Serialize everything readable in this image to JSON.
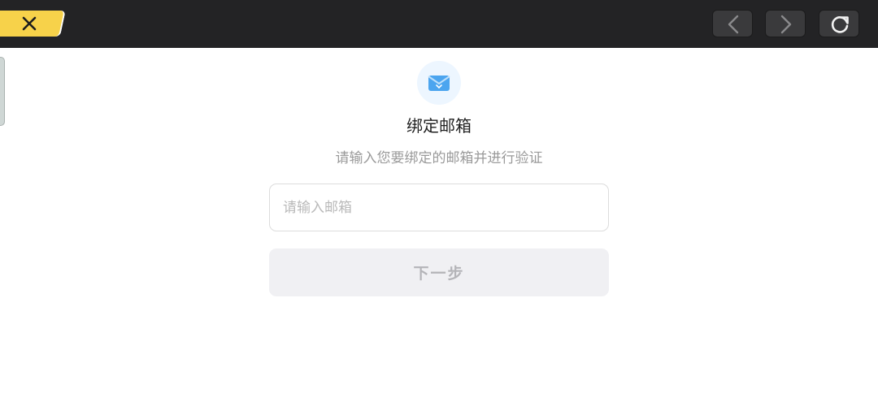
{
  "toolbar": {
    "close_icon": "close-icon",
    "back_icon": "chevron-left-icon",
    "forward_icon": "chevron-right-icon",
    "refresh_icon": "refresh-icon",
    "accent_color": "#f7d24a",
    "bar_color": "#232325"
  },
  "main": {
    "icon": "mail-icon",
    "title": "绑定邮箱",
    "subtitle": "请输入您要绑定的邮箱并进行验证",
    "email_placeholder": "请输入邮箱",
    "email_value": "",
    "next_label": "下一步"
  }
}
